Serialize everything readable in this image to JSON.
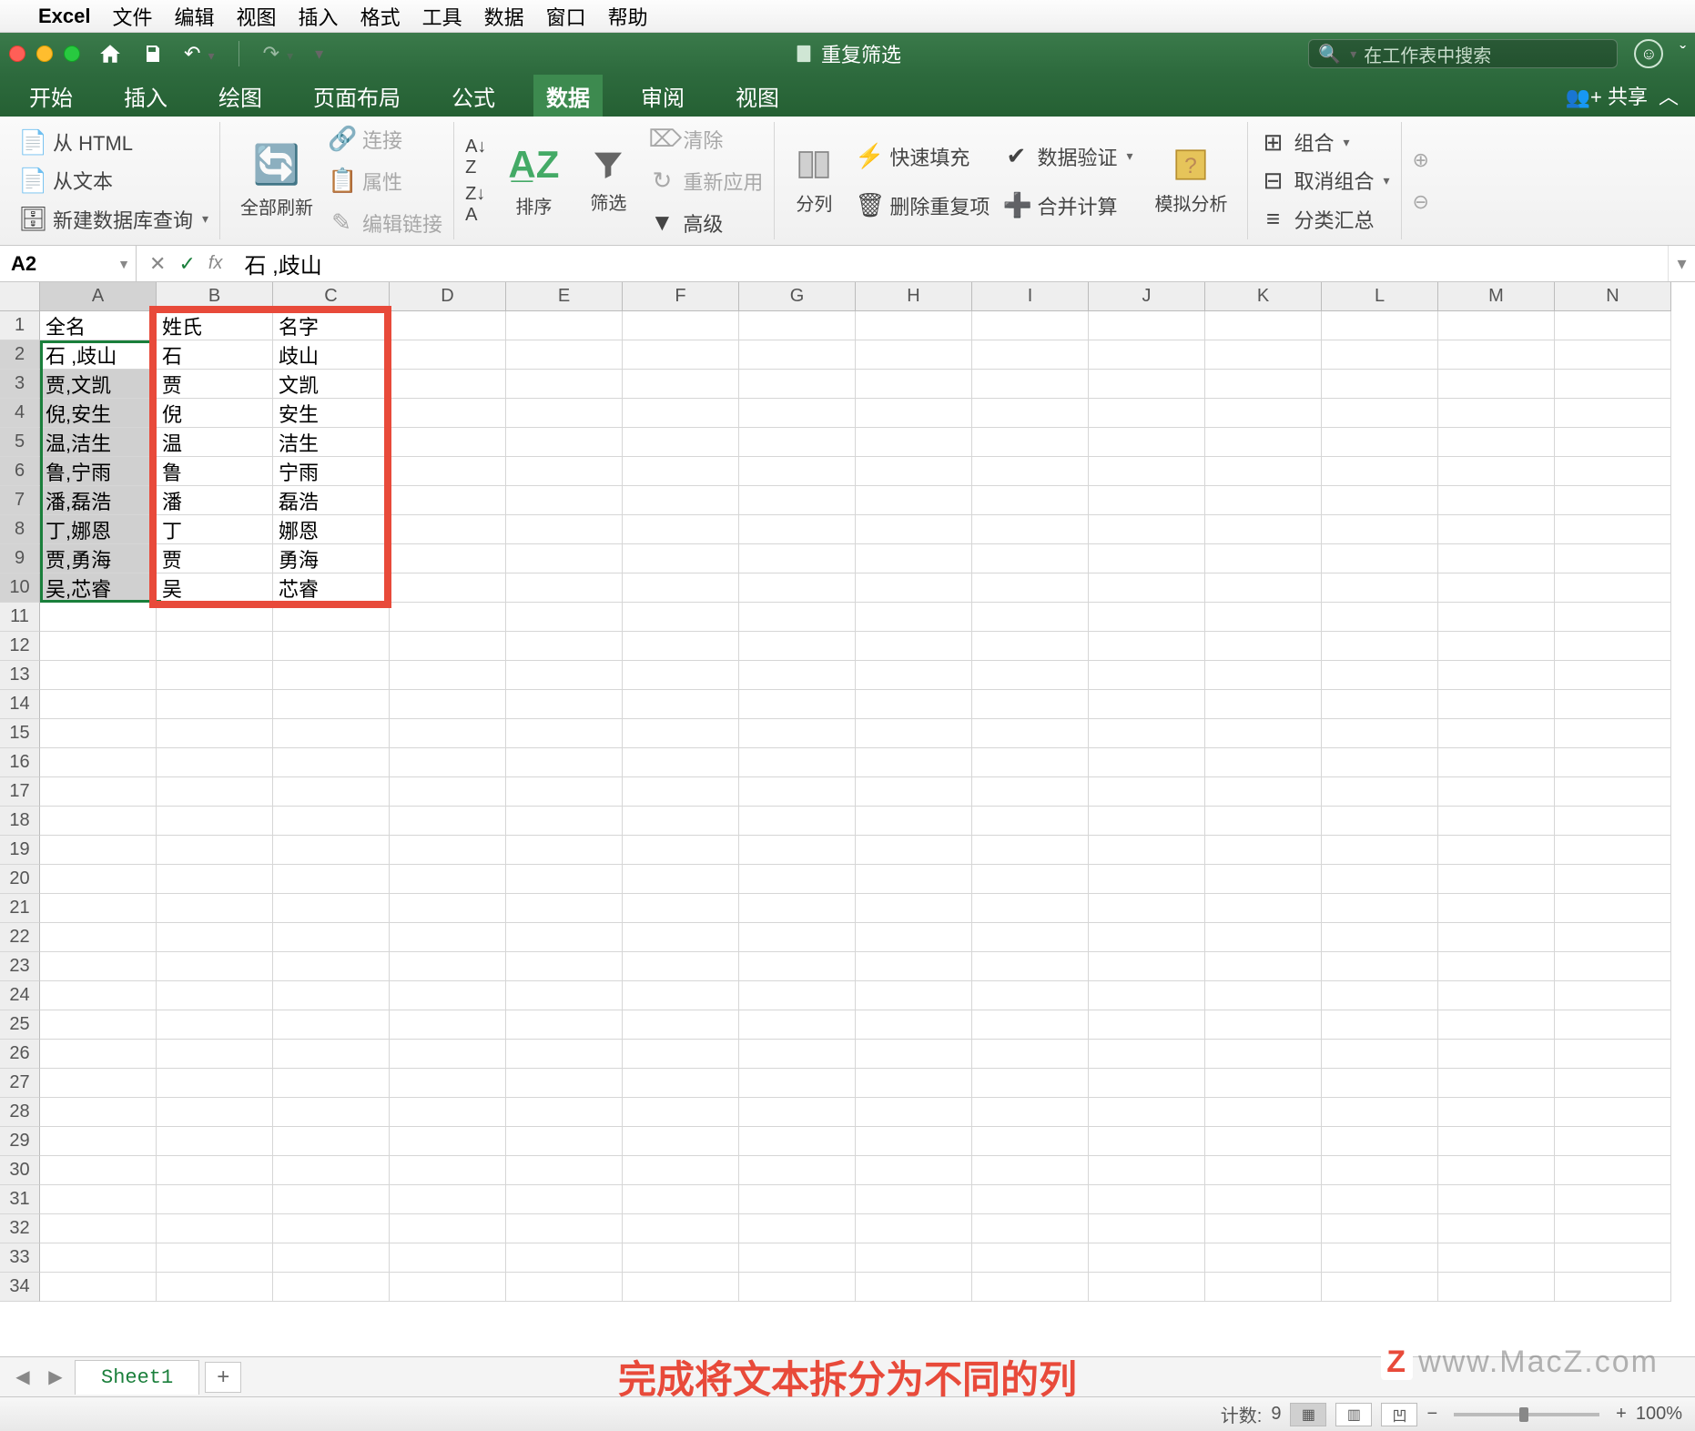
{
  "mac_menu": {
    "app": "Excel",
    "items": [
      "文件",
      "编辑",
      "视图",
      "插入",
      "格式",
      "工具",
      "数据",
      "窗口",
      "帮助"
    ]
  },
  "titlebar": {
    "doc_title": "重复筛选",
    "search_placeholder": "在工作表中搜索"
  },
  "tabs": {
    "items": [
      "开始",
      "插入",
      "绘图",
      "页面布局",
      "公式",
      "数据",
      "审阅",
      "视图"
    ],
    "active": 5,
    "share": "共享"
  },
  "ribbon": {
    "get_data": {
      "html": "从 HTML",
      "text": "从文本",
      "db": "新建数据库查询"
    },
    "refresh": {
      "label": "全部刷新",
      "conn": "连接",
      "prop": "属性",
      "edit": "编辑链接"
    },
    "sort": {
      "asc": "A→Z",
      "desc": "Z→A",
      "sort": "排序",
      "filter": "筛选",
      "clear": "清除",
      "reapply": "重新应用",
      "advanced": "高级"
    },
    "tools": {
      "split": "分列",
      "flash": "快速填充",
      "dup": "删除重复项",
      "validate": "数据验证",
      "consolidate": "合并计算",
      "whatif": "模拟分析"
    },
    "outline": {
      "group": "组合",
      "ungroup": "取消组合",
      "subtotal": "分类汇总"
    }
  },
  "formula": {
    "ref": "A2",
    "fx": "fx",
    "value": "石 ,歧山"
  },
  "grid": {
    "columns": [
      "A",
      "B",
      "C",
      "D",
      "E",
      "F",
      "G",
      "H",
      "I",
      "J",
      "K",
      "L",
      "M",
      "N"
    ],
    "headers_row": [
      "全名",
      "姓氏",
      "名字"
    ],
    "data": [
      [
        "石 ,歧山",
        "石",
        "歧山"
      ],
      [
        "贾,文凯",
        "贾",
        "文凯"
      ],
      [
        "倪,安生",
        "倪",
        "安生"
      ],
      [
        "温,洁生",
        "温",
        "洁生"
      ],
      [
        "鲁,宁雨",
        "鲁",
        "宁雨"
      ],
      [
        "潘,磊浩",
        "潘",
        "磊浩"
      ],
      [
        "丁,娜恩",
        "丁",
        "娜恩"
      ],
      [
        "贾,勇海",
        "贾",
        "勇海"
      ],
      [
        "吴,芯睿",
        "吴",
        "芯睿"
      ]
    ],
    "total_rows": 34
  },
  "sheets": {
    "active": "Sheet1"
  },
  "annotation": "完成将文本拆分为不同的列",
  "status": {
    "count_label": "计数:",
    "count": "9",
    "zoom": "100%"
  },
  "watermark": "www.MacZ.com"
}
